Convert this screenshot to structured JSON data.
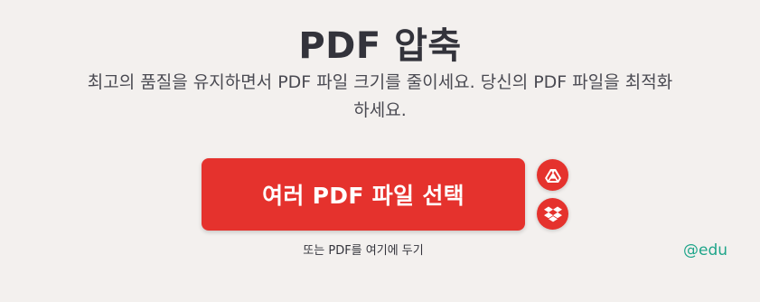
{
  "page": {
    "title": "PDF 압축",
    "subtitle_line1": "최고의 품질을 유지하면서 PDF 파일 크기를 줄이세요. 당신의 PDF 파일을 최적화",
    "subtitle_line2": "하세요."
  },
  "upload": {
    "select_button_label": "여러 PDF 파일 선택",
    "google_drive_icon": "google-drive-icon",
    "dropbox_icon": "dropbox-icon",
    "drop_hint": "또는 PDF를 여기에 두기"
  },
  "watermark": {
    "text": "@edu"
  },
  "colors": {
    "accent": "#e5322d",
    "background": "#f3f0ee",
    "title": "#33333b",
    "watermark": "#1fa58a"
  }
}
